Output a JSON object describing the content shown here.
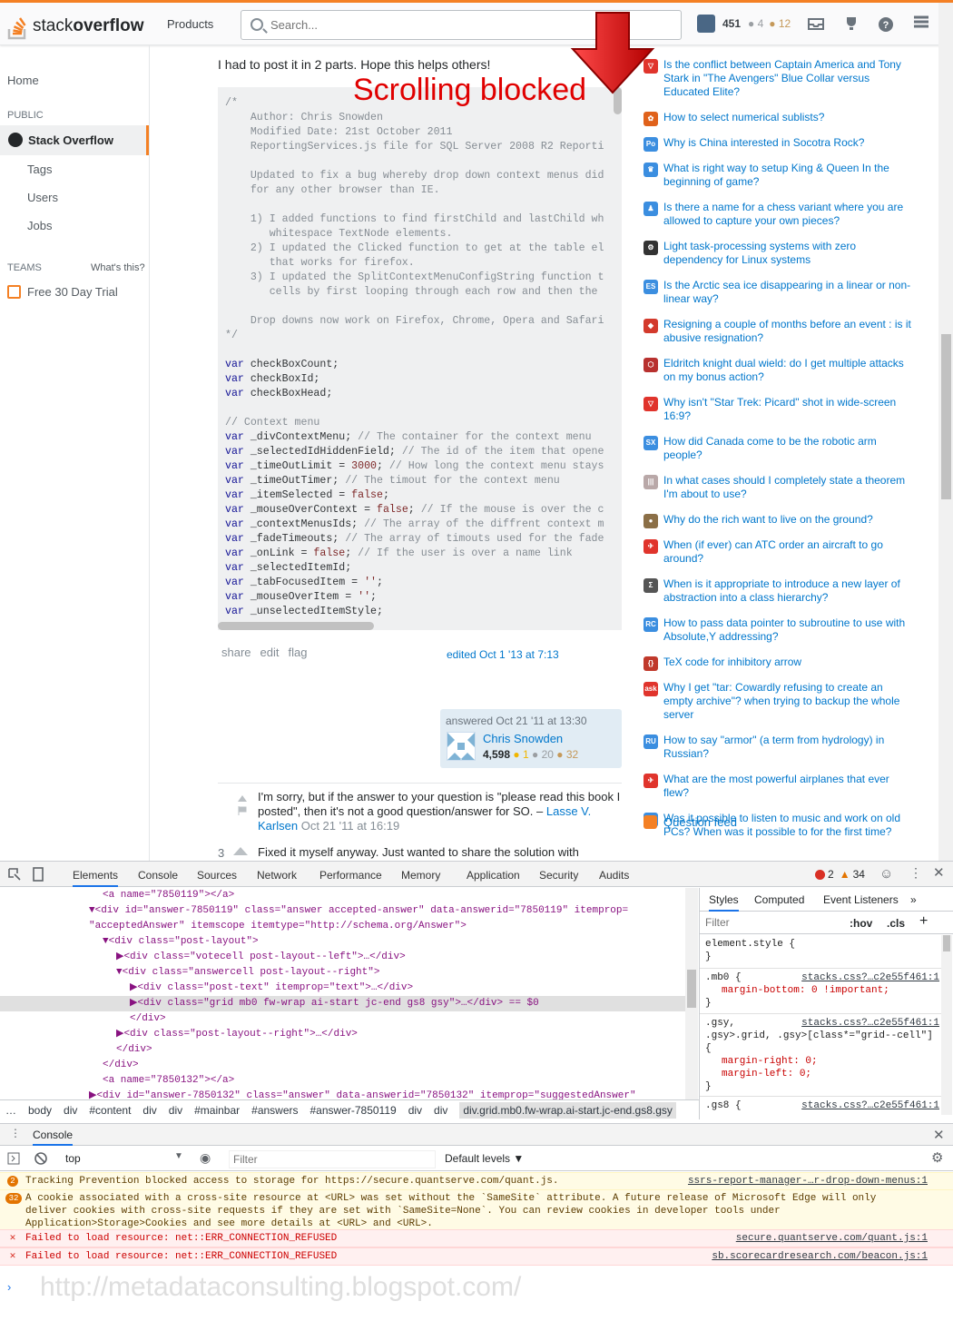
{
  "header": {
    "logo_text_a": "stack",
    "logo_text_b": "overflow",
    "products": "Products",
    "search_placeholder": "Search...",
    "reputation": "451",
    "silver": "● 4",
    "bronze": "● 12"
  },
  "leftnav": {
    "home": "Home",
    "public": "PUBLIC",
    "stackoverflow": "Stack Overflow",
    "tags": "Tags",
    "users": "Users",
    "jobs": "Jobs",
    "teams": "TEAMS",
    "whats_this": "What's this?",
    "trial": "Free 30 Day Trial"
  },
  "answer": {
    "intro": "I had to post it in 2 parts. Hope this helps others!",
    "annotation": "Scrolling blocked",
    "code_lines": [
      {
        "c": "/*",
        "k": "cm"
      },
      {
        "c": "    Author: Chris Snowden",
        "k": "cm"
      },
      {
        "c": "    Modified Date: 21st October 2011",
        "k": "cm"
      },
      {
        "c": "    ReportingServices.js file for SQL Server 2008 R2 Reporti",
        "k": "cm"
      },
      {
        "c": "",
        "k": "cm"
      },
      {
        "c": "    Updated to fix a bug whereby drop down context menus did",
        "k": "cm"
      },
      {
        "c": "    for any other browser than IE.",
        "k": "cm"
      },
      {
        "c": "",
        "k": "cm"
      },
      {
        "c": "    1) I added functions to find firstChild and lastChild wh",
        "k": "cm"
      },
      {
        "c": "       whitespace TextNode elements.",
        "k": "cm"
      },
      {
        "c": "    2) I updated the Clicked function to get at the table el",
        "k": "cm"
      },
      {
        "c": "       that works for firefox.",
        "k": "cm"
      },
      {
        "c": "    3) I updated the SplitContextMenuConfigString function t",
        "k": "cm"
      },
      {
        "c": "       cells by first looping through each row and then the",
        "k": "cm"
      },
      {
        "c": "",
        "k": "cm"
      },
      {
        "c": "    Drop downs now work on Firefox, Chrome, Opera and Safari",
        "k": "cm"
      },
      {
        "c": "*/",
        "k": "cm"
      },
      {
        "c": "",
        "k": "pl"
      },
      {
        "c": "var checkBoxCount;",
        "k": "pl"
      },
      {
        "c": "var checkBoxId;",
        "k": "pl"
      },
      {
        "c": "var checkBoxHead;",
        "k": "pl"
      },
      {
        "c": "",
        "k": "pl"
      },
      {
        "c": "// Context menu",
        "k": "cm"
      },
      {
        "c": "var _divContextMenu; // The container for the context menu",
        "k": "pl"
      },
      {
        "c": "var _selectedIdHiddenField; // The id of the item that opene",
        "k": "pl"
      },
      {
        "c": "var _timeOutLimit = 3000; // How long the context menu stays",
        "k": "pl"
      },
      {
        "c": "var _timeOutTimer; // The timout for the context menu",
        "k": "pl"
      },
      {
        "c": "var _itemSelected = false;",
        "k": "pl"
      },
      {
        "c": "var _mouseOverContext = false; // If the mouse is over the c",
        "k": "pl"
      },
      {
        "c": "var _contextMenusIds; // The array of the diffrent context m",
        "k": "pl"
      },
      {
        "c": "var _fadeTimeouts; // The array of timouts used for the fade",
        "k": "pl"
      },
      {
        "c": "var _onLink = false; // If the user is over a name link",
        "k": "pl"
      },
      {
        "c": "var _selectedItemId;",
        "k": "pl"
      },
      {
        "c": "var _tabFocusedItem = '';",
        "k": "pl"
      },
      {
        "c": "var _mouseOverItem = '';",
        "k": "pl"
      },
      {
        "c": "var _unselectedItemStyle;",
        "k": "pl"
      }
    ],
    "share": "share",
    "edit": "edit",
    "flag": "flag",
    "edited": "edited Oct 1 '13 at 7:13",
    "answered": "answered Oct 21 '11 at 13:30",
    "author": "Chris Snowden",
    "author_rep": "4,598",
    "author_gold": "● 1",
    "author_silver": "● 20",
    "author_bronze": "● 32"
  },
  "comment": {
    "text": "I'm sorry, but if the answer to your question is \"please read this book I posted\", then it's not a good question/answer for SO. –",
    "user": "Lasse V. Karlsen",
    "date": "Oct 21 '11 at 16:19"
  },
  "answer3": {
    "votes": "3",
    "text": "Fixed it myself anyway. Just wanted to share the solution with"
  },
  "hot_questions": [
    {
      "t": "Is the conflict between Captain America and Tony Stark in \"The Avengers\" Blue Collar versus Educated Elite?",
      "c": "#e0342c",
      "i": "▽"
    },
    {
      "t": "How to select numerical sublists?",
      "c": "#e0621b",
      "i": "✿"
    },
    {
      "t": "Why is China interested in Socotra Rock?",
      "c": "#3b8ee0",
      "i": "Po"
    },
    {
      "t": "What is right way to setup King & Queen In the beginning of game?",
      "c": "#3b8ee0",
      "i": "♛"
    },
    {
      "t": "Is there a name for a chess variant where you are allowed to capture your own pieces?",
      "c": "#3b8ee0",
      "i": "♟"
    },
    {
      "t": "Light task-processing systems with zero dependency for Linux systems",
      "c": "#333333",
      "i": "⚙"
    },
    {
      "t": "Is the Arctic sea ice disappearing in a linear or non-linear way?",
      "c": "#3b8ee0",
      "i": "ES"
    },
    {
      "t": "Resigning a couple of months before an event : is it abusive resignation?",
      "c": "#d33a2c",
      "i": "◆"
    },
    {
      "t": "Eldritch knight dual wield: do I get multiple attacks on my bonus action?",
      "c": "#b8312f",
      "i": "⬡"
    },
    {
      "t": "Why isn't \"Star Trek: Picard\" shot in wide-screen 16:9?",
      "c": "#e0342c",
      "i": "▽"
    },
    {
      "t": "How did Canada come to be the robotic arm people?",
      "c": "#3b8ee0",
      "i": "SX"
    },
    {
      "t": "In what cases should I completely state a theorem I'm about to use?",
      "c": "#b9a8a8",
      "i": "|||"
    },
    {
      "t": "Why do the rich want to live on the ground?",
      "c": "#8b6f47",
      "i": "●"
    },
    {
      "t": "When (if ever) can ATC order an aircraft to go around?",
      "c": "#e0342c",
      "i": "✈"
    },
    {
      "t": "When is it appropriate to introduce a new layer of abstraction into a class hierarchy?",
      "c": "#555555",
      "i": "Σ"
    },
    {
      "t": "How to pass data pointer to subroutine to use with Absolute,Y addressing?",
      "c": "#3b8ee0",
      "i": "RC"
    },
    {
      "t": "TeX code for inhibitory arrow",
      "c": "#c0392b",
      "i": "{}"
    },
    {
      "t": "Why I get \"tar: Cowardly refusing to create an empty archive\"? when trying to backup the whole server",
      "c": "#e0342c",
      "i": "ask"
    },
    {
      "t": "How to say \"armor\" (a term from hydrology) in Russian?",
      "c": "#3b8ee0",
      "i": "RU"
    },
    {
      "t": "What are the most powerful airplanes that ever flew?",
      "c": "#e0342c",
      "i": "✈"
    },
    {
      "t": "Was it possible to listen to music and work on old PCs? When was it possible to for the first time?",
      "c": "#3b8ee0",
      "i": "RC"
    }
  ],
  "question_feed": "Question feed",
  "devtools": {
    "tabs": [
      "Elements",
      "Console",
      "Sources",
      "Network",
      "Performance",
      "Memory",
      "Application",
      "Security",
      "Audits"
    ],
    "errors": "2",
    "warnings": "34",
    "dom_lines": [
      {
        "i": 7,
        "h": "<a name=\"7850119\"></a>",
        "sel": false
      },
      {
        "i": 6,
        "h": "▼<div id=\"answer-7850119\" class=\"answer accepted-answer\" data-answerid=\"7850119\" itemprop=",
        "sel": false
      },
      {
        "i": 6,
        "h": "\"acceptedAnswer\" itemscope itemtype=\"http://schema.org/Answer\">",
        "sel": false
      },
      {
        "i": 7,
        "h": "▼<div class=\"post-layout\">",
        "sel": false
      },
      {
        "i": 8,
        "h": "▶<div class=\"votecell post-layout--left\">…</div>",
        "sel": false
      },
      {
        "i": 8,
        "h": "▼<div class=\"answercell post-layout--right\">",
        "sel": false
      },
      {
        "i": 9,
        "h": "▶<div class=\"post-text\" itemprop=\"text\">…</div>",
        "sel": false
      },
      {
        "i": 9,
        "h": "▶<div class=\"grid mb0 fw-wrap ai-start jc-end gs8 gsy\">…</div> == $0",
        "sel": true
      },
      {
        "i": 9,
        "h": "</div>",
        "sel": false
      },
      {
        "i": 8,
        "h": "▶<div class=\"post-layout--right\">…</div>",
        "sel": false
      },
      {
        "i": 8,
        "h": "</div>",
        "sel": false
      },
      {
        "i": 7,
        "h": "</div>",
        "sel": false
      },
      {
        "i": 7,
        "h": "<a name=\"7850132\"></a>",
        "sel": false
      },
      {
        "i": 6,
        "h": "▶<div id=\"answer-7850132\" class=\"answer\" data-answerid=\"7850132\" itemprop=\"suggestedAnswer\"",
        "sel": false
      }
    ],
    "breadcrumb": [
      "…",
      "body",
      "div",
      "#content",
      "div",
      "div",
      "#mainbar",
      "#answers",
      "#answer-7850119",
      "div",
      "div"
    ],
    "breadcrumb_current": "div.grid.mb0.fw-wrap.ai-start.jc-end.gs8.gsy",
    "style_tabs": [
      "Styles",
      "Computed",
      "Event Listeners"
    ],
    "filter_placeholder": "Filter",
    "hov": ":hov",
    "cls": ".cls",
    "rules": [
      {
        "sel": "element.style {",
        "src": "",
        "props": [],
        "close": "}"
      },
      {
        "sel": ".mb0 {",
        "src": "stacks.css?…c2e55f461:1",
        "props": [
          "margin-bottom: 0 !important;"
        ],
        "close": "}"
      },
      {
        "sel": ".gsy,\n.gsy>.grid, .gsy>[class*=\"grid--cell\"]\n{",
        "src": "stacks.css?…c2e55f461:1",
        "props": [
          "margin-right: 0;",
          "margin-left: 0;"
        ],
        "close": "}"
      },
      {
        "sel": ".gs8 {",
        "src": "stacks.css?…c2e55f461:1",
        "props": [],
        "close": ""
      }
    ],
    "console": {
      "tab": "Console",
      "context": "top",
      "filter": "Filter",
      "levels": "Default levels ▼",
      "messages": [
        {
          "type": "warn",
          "badge": "2",
          "text": "Tracking Prevention blocked access to storage for https://secure.quantserve.com/quant.js.",
          "src": "ssrs-report-manager-…r-drop-down-menus:1"
        },
        {
          "type": "warn",
          "badge": "32",
          "text": "A cookie associated with a cross-site resource at <URL> was set without the `SameSite` attribute. A future release of Microsoft Edge will only\ndeliver cookies with cross-site requests if they are set with `SameSite=None`. You can review cookies in developer tools under\nApplication>Storage>Cookies and see more details at <URL> and <URL>.",
          "src": ""
        },
        {
          "type": "err",
          "badge": "✕",
          "text": "Failed to load resource: net::ERR_CONNECTION_REFUSED",
          "src": "secure.quantserve.com/quant.js:1"
        },
        {
          "type": "err",
          "badge": "✕",
          "text": "Failed to load resource: net::ERR_CONNECTION_REFUSED",
          "src": "sb.scorecardresearch.com/beacon.js:1"
        }
      ]
    }
  },
  "watermark": "http://metadataconsulting.blogspot.com/",
  "colors": {
    "accent": "#f48024",
    "link": "#0077cc",
    "annotation": "#e00000"
  }
}
